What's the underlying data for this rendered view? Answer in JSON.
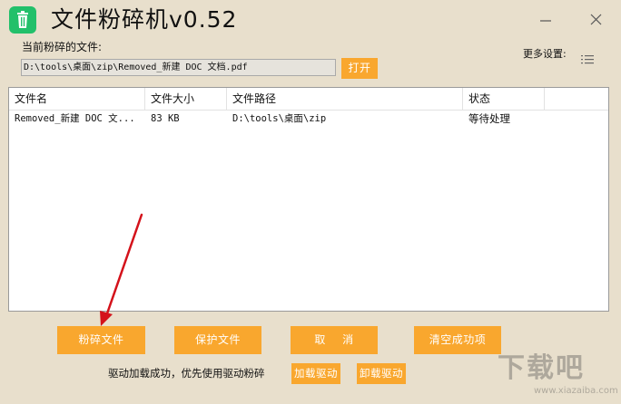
{
  "window": {
    "title": "文件粉碎机v0.52",
    "icon": "trash-icon",
    "accent": "#f9a72e",
    "icon_color": "#22c06a"
  },
  "current_file": {
    "label": "当前粉碎的文件:",
    "path": "D:\\tools\\桌面\\zip\\Removed_新建 DOC 文档.pdf",
    "open_label": "打开"
  },
  "settings": {
    "label": "更多设置:"
  },
  "table": {
    "headers": [
      "文件名",
      "文件大小",
      "文件路径",
      "状态"
    ],
    "rows": [
      {
        "name": "Removed_新建 DOC 文...",
        "size": "83  KB",
        "path": "D:\\tools\\桌面\\zip",
        "status": "等待处理"
      }
    ]
  },
  "actions": {
    "shred": "粉碎文件",
    "protect": "保护文件",
    "cancel": "取 消",
    "clear": "清空成功项"
  },
  "driver": {
    "status": "驱动加载成功，优先使用驱动粉碎",
    "load": "加载驱动",
    "unload": "卸载驱动"
  },
  "watermark": {
    "text": "下载吧",
    "url": "www.xiazaiba.com"
  }
}
